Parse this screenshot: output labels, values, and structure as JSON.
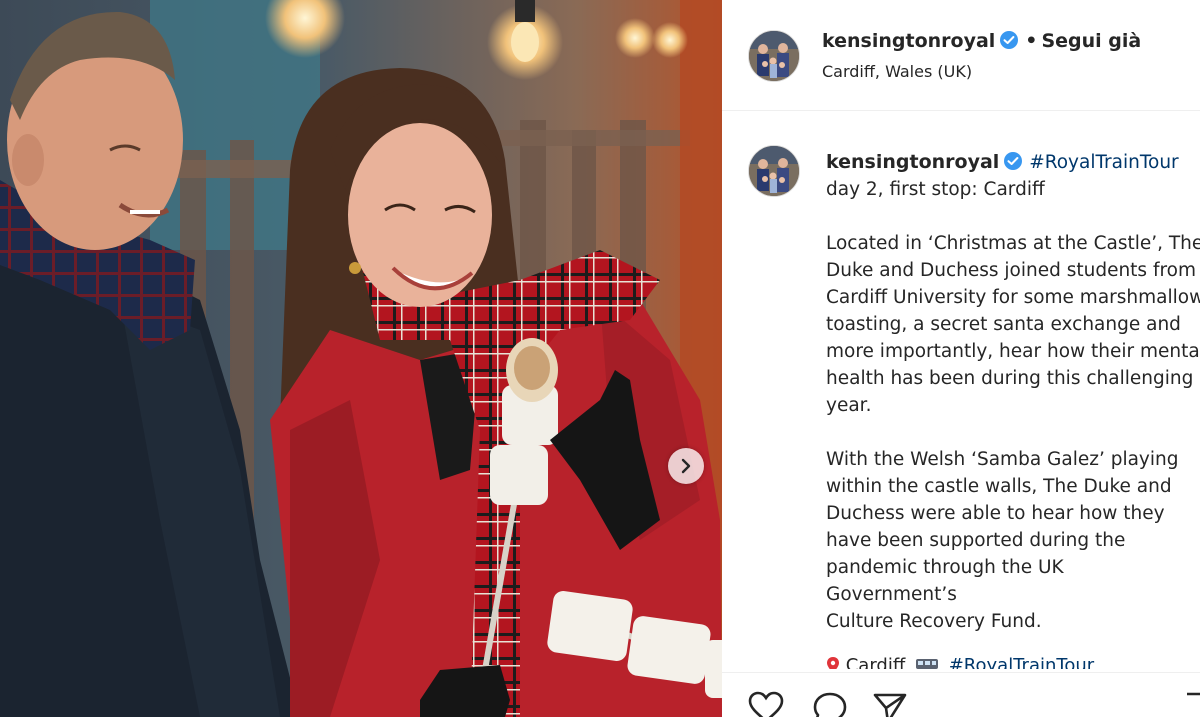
{
  "post": {
    "username": "kensingtonroyal",
    "follow_separator": "•",
    "follow_label": "Segui già",
    "location": "Cardiff, Wales (UK)",
    "more_label": "..."
  },
  "caption": {
    "username": "kensingtonroyal",
    "hashtag": "#RoyalTrainTour",
    "line1": "day 2, first stop: Cardiff",
    "paragraph1": "Located in ‘Christmas at the Castle’, The Duke and Duchess joined students from Cardiff University for some marshmallow toasting, a secret santa exchange and more importantly, hear how their mental health has been during this challenging year.",
    "paragraph2_lines": [
      "With the Welsh ‘Samba Galez’ playing",
      "within the castle walls, The Duke and",
      "Duchess were able to hear how they",
      "have been supported during the",
      "pandemic through the UK",
      "Government’s",
      "Culture Recovery Fund."
    ],
    "cut_location": "Cardiff",
    "cut_hashtag": "#RoyalTrainTour"
  },
  "icons": {
    "verified": "verified-badge-icon",
    "next": "chevron-right-icon",
    "like": "heart-icon",
    "comment": "comment-icon",
    "share": "send-icon",
    "save": "bookmark-icon"
  },
  "colors": {
    "verified_blue": "#3897f0",
    "hashtag_blue": "#00376b",
    "text": "#262626",
    "divider": "#efefef"
  }
}
